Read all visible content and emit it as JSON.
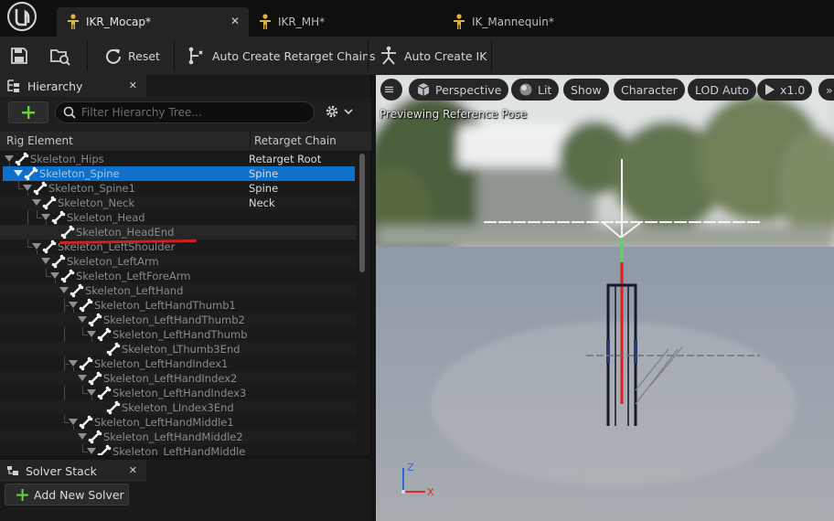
{
  "tabs": [
    {
      "label": "IKR_Mocap*",
      "active": true
    },
    {
      "label": "IKR_MH*",
      "active": false
    },
    {
      "label": "IK_Mannequin*",
      "active": false
    }
  ],
  "toolbar": {
    "reset": "Reset",
    "auto_chains": "Auto Create Retarget Chains",
    "auto_ik": "Auto Create IK"
  },
  "hierarchy": {
    "title": "Hierarchy",
    "search_placeholder": "Filter Hierarchy Tree...",
    "col_element": "Rig Element",
    "col_chain": "Retarget Chain",
    "rows": [
      {
        "name": "Skeleton_Hips",
        "chain": "Retarget Root",
        "depth": 0,
        "arrow": true
      },
      {
        "name": "Skeleton_Spine",
        "chain": "Spine",
        "depth": 1,
        "arrow": true,
        "selected": true
      },
      {
        "name": "Skeleton_Spine1",
        "chain": "Spine",
        "depth": 2,
        "arrow": true
      },
      {
        "name": "Skeleton_Neck",
        "chain": "Neck",
        "depth": 3,
        "arrow": true
      },
      {
        "name": "Skeleton_Head",
        "chain": "",
        "depth": 4,
        "arrow": true
      },
      {
        "name": "Skeleton_HeadEnd",
        "chain": "",
        "depth": 5,
        "arrow": false,
        "highlight": true
      },
      {
        "name": "Skeleton_LeftShoulder",
        "chain": "",
        "depth": 3,
        "arrow": true
      },
      {
        "name": "Skeleton_LeftArm",
        "chain": "",
        "depth": 4,
        "arrow": true
      },
      {
        "name": "Skeleton_LeftForeArm",
        "chain": "",
        "depth": 5,
        "arrow": true
      },
      {
        "name": "Skeleton_LeftHand",
        "chain": "",
        "depth": 6,
        "arrow": true
      },
      {
        "name": "Skeleton_LeftHandThumb1",
        "chain": "",
        "depth": 7,
        "arrow": true
      },
      {
        "name": "Skeleton_LeftHandThumb2",
        "chain": "",
        "depth": 8,
        "arrow": true
      },
      {
        "name": "Skeleton_LeftHandThumb",
        "chain": "",
        "depth": 9,
        "arrow": true
      },
      {
        "name": "Skeleton_LThumb3End",
        "chain": "",
        "depth": 10,
        "arrow": false
      },
      {
        "name": "Skeleton_LeftHandIndex1",
        "chain": "",
        "depth": 7,
        "arrow": true
      },
      {
        "name": "Skeleton_LeftHandIndex2",
        "chain": "",
        "depth": 8,
        "arrow": true
      },
      {
        "name": "Skeleton_LeftHandIndex3",
        "chain": "",
        "depth": 9,
        "arrow": true
      },
      {
        "name": "Skeleton_LIndex3End",
        "chain": "",
        "depth": 10,
        "arrow": false
      },
      {
        "name": "Skeleton_LeftHandMiddle1",
        "chain": "",
        "depth": 7,
        "arrow": true
      },
      {
        "name": "Skeleton_LeftHandMiddle2",
        "chain": "",
        "depth": 8,
        "arrow": true
      },
      {
        "name": "Skeleton_LeftHandMiddle",
        "chain": "",
        "depth": 9,
        "arrow": true
      }
    ]
  },
  "solver": {
    "title": "Solver Stack",
    "add_label": "Add New Solver"
  },
  "viewport": {
    "perspective": "Perspective",
    "lit": "Lit",
    "show": "Show",
    "character": "Character",
    "lod": "LOD Auto",
    "speed": "x1.0",
    "preview_text": "Previewing Reference Pose",
    "axis_z": "Z",
    "axis_x": "X"
  },
  "colors": {
    "selection": "#0e70c8",
    "annotation_red": "#d21f1f",
    "add_green": "#6fcf3f"
  }
}
